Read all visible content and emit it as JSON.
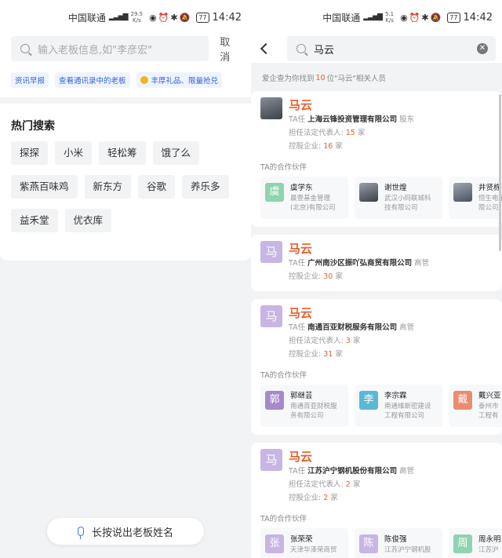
{
  "status": {
    "carrier": "中国联通",
    "speed_top": "29.5",
    "speed_bottom": "K/s",
    "battery": "77",
    "time": "14:42"
  },
  "status_right": {
    "carrier": "中国联通",
    "speed_top": "5.1",
    "speed_bottom": "K/s",
    "battery": "77",
    "time": "14:42"
  },
  "left": {
    "search_placeholder": "输入老板信息,如\"李彦宏\"",
    "cancel_label": "取消",
    "tags": [
      "资讯早报",
      "查看通讯录中的老板",
      "丰厚礼品、限量抢兑"
    ],
    "hot_title": "热门搜索",
    "hot_items": [
      "探探",
      "小米",
      "轻松筹",
      "饿了么",
      "紫燕百味鸡",
      "新东方",
      "谷歌",
      "养乐多",
      "益禾堂",
      "优衣库"
    ],
    "voice_label": "长按说出老板姓名"
  },
  "right": {
    "query": "马云",
    "result_prefix": "爱企查为你找到",
    "result_num": "10",
    "result_suffix": "位\"马云\"相关人员",
    "cards": [
      {
        "avatar": "",
        "name": "马云",
        "role_prefix": "TA任",
        "company": "上海云锋投资管理有限公司",
        "role": "股东",
        "rep_label": "担任法定代表人:",
        "rep_num": "15",
        "rep_unit": "家",
        "hold_label": "控股企业:",
        "hold_num": "16",
        "hold_unit": "家",
        "partner_title": "TA的合作伙伴",
        "partners": [
          {
            "av": "虞",
            "color": "#8fd3b1",
            "name": "虞学东",
            "co1": "晨壹基金管理",
            "co2": "(北京)有限公司"
          },
          {
            "av": "",
            "color": "#4a4f57",
            "name": "谢世煌",
            "co1": "武汉小码联城科",
            "co2": "技有限公司"
          },
          {
            "av": "",
            "color": "#5a6270",
            "name": "井贤栋",
            "co1": "恒生电子",
            "co2": "限公司"
          }
        ]
      },
      {
        "avatar": "马",
        "name": "马云",
        "role_prefix": "TA任",
        "company": "广州南沙区振吖弘商贸有限公司",
        "role": "高管",
        "hold_label": "控股企业:",
        "hold_num": "30",
        "hold_unit": "家"
      },
      {
        "avatar": "马",
        "name": "马云",
        "role_prefix": "TA任",
        "company": "南通百亚财税服务有限公司",
        "role": "高管",
        "rep_label": "担任法定代表人:",
        "rep_num": "3",
        "rep_unit": "家",
        "hold_label": "控股企业:",
        "hold_num": "31",
        "hold_unit": "家",
        "partner_title": "TA的合作伙伴",
        "partners": [
          {
            "av": "郭",
            "color": "#a58bc9",
            "name": "郭继芸",
            "co1": "南通百亚财税服",
            "co2": "务有限公司"
          },
          {
            "av": "李",
            "color": "#5bb7d6",
            "name": "李宗霖",
            "co1": "南通维斯密建设",
            "co2": "工程有限公司"
          },
          {
            "av": "戴",
            "color": "#e98c6f",
            "name": "戴兴亚",
            "co1": "泰州市",
            "co2": "工程有"
          }
        ]
      },
      {
        "avatar": "马",
        "name": "马云",
        "role_prefix": "TA任",
        "company": "江苏沪宁钢机股份有限公司",
        "role": "高管",
        "rep_label": "担任法定代表人:",
        "rep_num": "2",
        "rep_unit": "家",
        "hold_label": "控股企业:",
        "hold_num": "2",
        "hold_unit": "家",
        "partner_title": "TA的合作伙伴",
        "partners": [
          {
            "av": "张",
            "color": "#c7b5e3",
            "name": "张荣荣",
            "co1": "天津华泽荣商贸",
            "co2": ""
          },
          {
            "av": "陈",
            "color": "#c7b5e3",
            "name": "陈俊强",
            "co1": "江苏沪宁钢机股",
            "co2": ""
          },
          {
            "av": "周",
            "color": "#8fd3b1",
            "name": "周永明",
            "co1": "江苏沪",
            "co2": ""
          }
        ]
      }
    ]
  }
}
